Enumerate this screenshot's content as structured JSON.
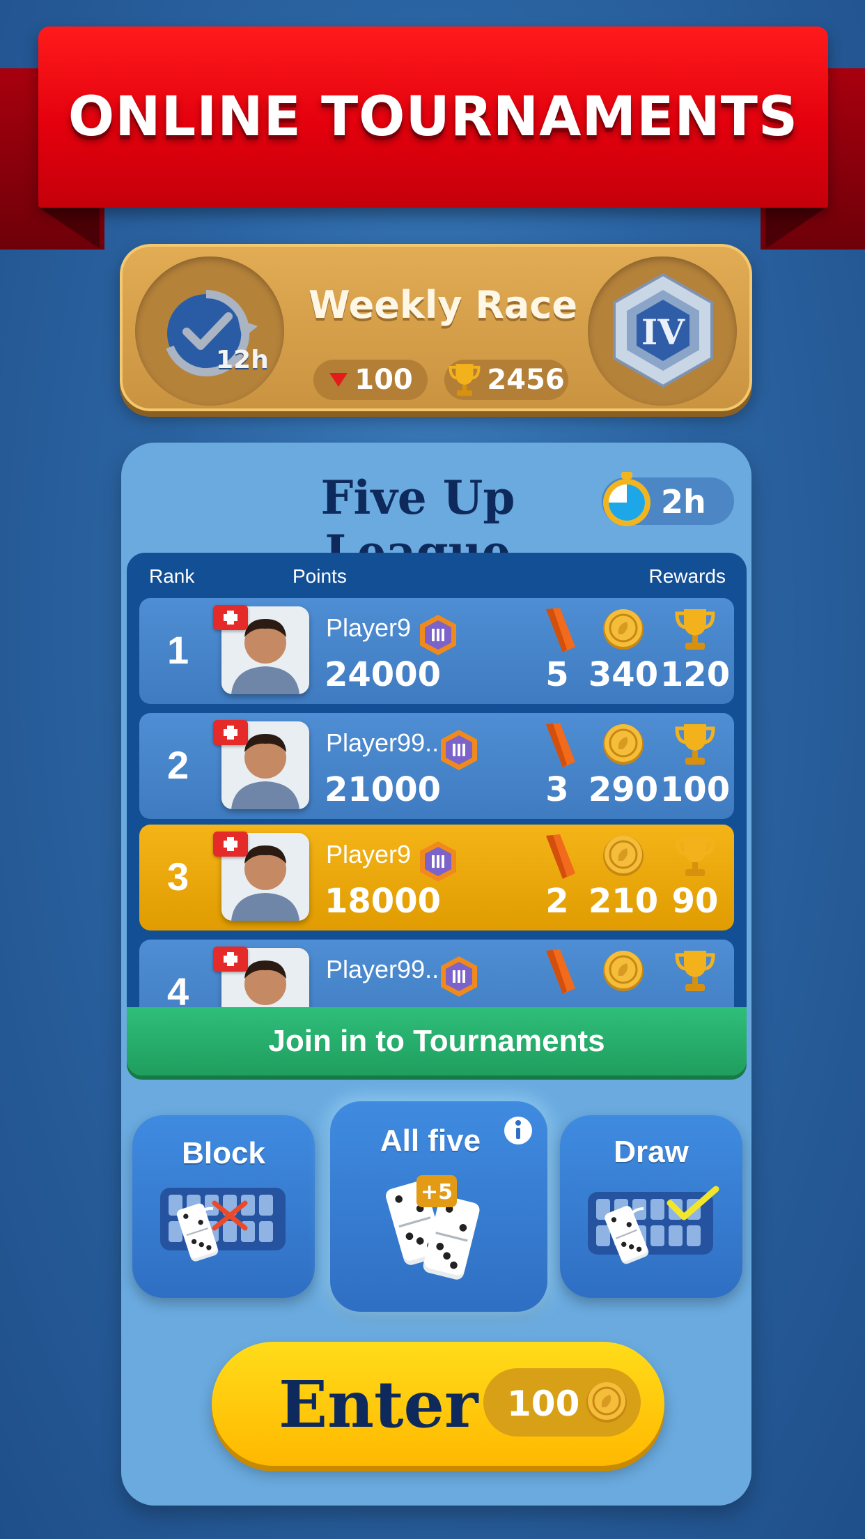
{
  "banner": {
    "title": "ONLINE TOURNAMENTS"
  },
  "weekly_race": {
    "title": "Weekly Race",
    "timer": "12h",
    "rank_value": "100",
    "trophy_value": "2456",
    "badge_numeral": "IV"
  },
  "league": {
    "title": "Five Up League",
    "timer": "2h",
    "headers": {
      "rank": "Rank",
      "points": "Points",
      "rewards": "Rewards"
    },
    "rows": [
      {
        "rank": "1",
        "name": "Player9",
        "league_badge": "III",
        "points": "24000",
        "tickets": "5",
        "coins": "340",
        "trophies": "120",
        "highlight": false
      },
      {
        "rank": "2",
        "name": "Player99..",
        "league_badge": "III",
        "points": "21000",
        "tickets": "3",
        "coins": "290",
        "trophies": "100",
        "highlight": false
      },
      {
        "rank": "3",
        "name": "Player9",
        "league_badge": "III",
        "points": "18000",
        "tickets": "2",
        "coins": "210",
        "trophies": "90",
        "highlight": true
      },
      {
        "rank": "4",
        "name": "Player99..",
        "league_badge": "III"
      }
    ],
    "join_button": "Join in to Tournaments"
  },
  "modes": {
    "block": {
      "label": "Block",
      "icon": "block-domino-icon"
    },
    "all_five": {
      "label": "All five",
      "bonus": "+5",
      "icon": "all-five-dominoes-icon"
    },
    "draw": {
      "label": "Draw",
      "icon": "draw-domino-icon"
    }
  },
  "enter": {
    "label": "Enter",
    "cost": "100"
  },
  "colors": {
    "banner_red": "#e3000d",
    "weekly_gold": "#d9a34b",
    "league_panel": "#6aaadf",
    "board_blue": "#134f95",
    "highlight_row": "#f0ad0c",
    "join_green": "#25ad6a",
    "enter_yellow": "#ffc80a"
  }
}
